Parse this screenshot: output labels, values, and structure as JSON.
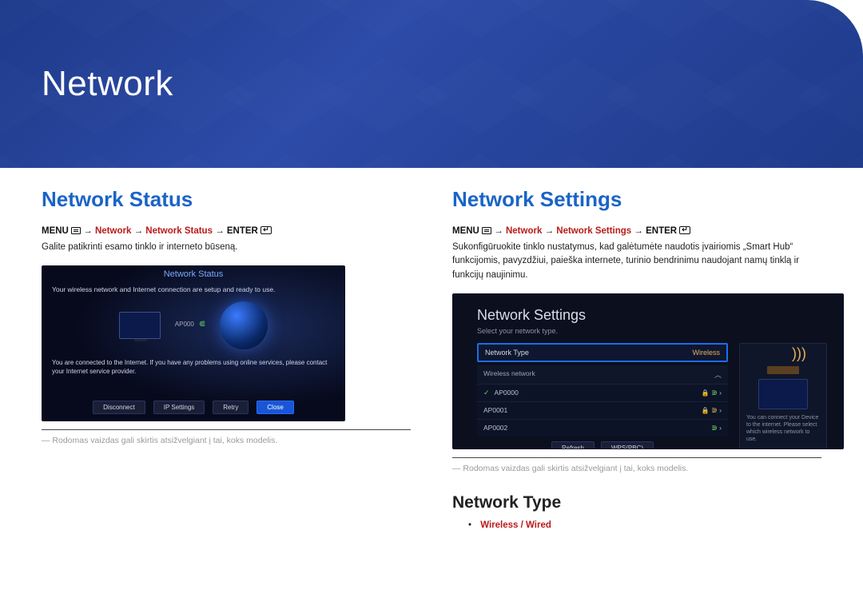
{
  "banner": {
    "title": "Network"
  },
  "status": {
    "heading": "Network Status",
    "crumb": {
      "menu": "MENU",
      "p1": "Network",
      "p2": "Network Status",
      "enter": "ENTER"
    },
    "desc": "Galite patikrinti esamo tinklo ir interneto būseną.",
    "mock": {
      "title": "Network Status",
      "msg1": "Your wireless network and Internet connection are setup and ready to use.",
      "ap": "AP000",
      "msg2": "You are connected to the Internet. If you have any problems using online services, please contact your Internet service provider.",
      "buttons": [
        "Disconnect",
        "IP Settings",
        "Retry",
        "Close"
      ]
    },
    "footnote": "― Rodomas vaizdas gali skirtis atsižvelgiant į tai, koks modelis."
  },
  "settings": {
    "heading": "Network Settings",
    "crumb": {
      "menu": "MENU",
      "p1": "Network",
      "p2": "Network Settings",
      "enter": "ENTER"
    },
    "desc": "Sukonfigūruokite tinklo nustatymus, kad galėtumėte naudotis įvairiomis „Smart Hub“ funkcijomis, pavyzdžiui, paieška internete, turinio bendrinimu naudojant namų tinklą ir funkcijų naujinimu.",
    "mock": {
      "title": "Network Settings",
      "sub": "Select your network type.",
      "ntype_label": "Network Type",
      "ntype_value": "Wireless",
      "wireless_header": "Wireless network",
      "rows": [
        "AP0000",
        "AP0001",
        "AP0002"
      ],
      "buttons": [
        "Refresh",
        "WPS(PBC)"
      ],
      "side_text": "You can connect your Device to the internet. Please select which wireless network to use."
    },
    "footnote": "― Rodomas vaizdas gali skirtis atsižvelgiant į tai, koks modelis.",
    "subheading": "Network Type",
    "options": {
      "a": "Wireless",
      "sep": " / ",
      "b": "Wired"
    }
  }
}
